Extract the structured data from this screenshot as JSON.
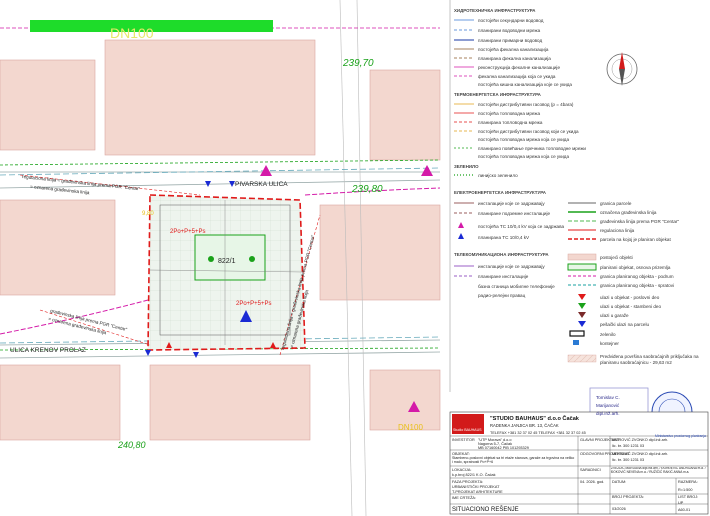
{
  "banner": {
    "label": "DN100"
  },
  "elevations": [
    "239,70",
    "239,80",
    "240,80"
  ],
  "dn_label_right": "DN100",
  "streets": {
    "pivarska": "PIVARSKA ULICA",
    "krenov": "ULICA KRENOV PROLAZ"
  },
  "plot_labels": {
    "parcel": "822/1",
    "building_top": "2Po+P+5+Ps",
    "building_bottom": "2Po+P+5+Ps",
    "corner": "9,80"
  },
  "diagonal_labels": {
    "left_a": "građevinska linija prema PGR \"Centar\"",
    "left_b": "= oznarena građevinska linija",
    "top_a": "regulaciona linija = građevinska linija prema PGR \"Centar\"",
    "top_b": "= oznarena građevinska linija",
    "right_a": "regulaciona linija = građevinska linija prema PGR \"Centar\"",
    "right_b": "= oznarena građevinska linija"
  },
  "legend_upper": {
    "sections": [
      {
        "title": "ХИДРОТЕХНИЧКА ИНФРАСТРУКТУРА",
        "items": [
          "постојећи секундарни водовод",
          "планирани водоводни мрежа",
          "планирани примарни водовод",
          "постојећа фекална канализација",
          "планирана фекална канализација",
          "реконструкција фекалне канализације",
          "фекална канализација која се укида",
          "постојећа кишна канализација које се укида"
        ]
      },
      {
        "title": "ТЕРМОЕНЕРГЕТСКА ИНФРАСТРУКТУРА",
        "items": [
          "постојећи дистрибутивни гасовод (p = 4bara)",
          "постојећа топловодна мрежа",
          "планирана топловодна мрежа",
          "постојећи дистрибутивни гасовод који се укида",
          "постојећа топловодна мрежа која се укида",
          "планирано повећање пречника топловодне мрежи",
          "постојећа топловодна мрежа која се укида"
        ]
      },
      {
        "title": "ЗЕЛЕНИЛО",
        "items": [
          "линијско зеленило"
        ]
      },
      {
        "title": "ЕЛЕКТРОЕНЕРГЕТСКА ИНФРАСТРУКТУРА",
        "items": [
          "инсталације које се задржавају",
          "планиране подземне инсталације",
          "постојећа ТС 10/0,4 kV која се задржава",
          "планирана ТС 10/0,4 kV"
        ]
      },
      {
        "title": "ТЕЛЕКОМУНИКАЦИОНА ИНФРАСТРУКТУРА",
        "items": [
          "инсталације које се задржавају",
          "планиране инсталације",
          "базна станица мобилне телефоније",
          "радио-релејни правац"
        ]
      }
    ]
  },
  "legend_lower": [
    "granica parcele",
    "označena građevinska linija",
    "građevinska linija prema PGR \"Centar\"",
    "regulaciona linija",
    "parcela na kojoj je planiran objekat",
    "postojeći objekti",
    "planirani objekat, osnova prizemlja",
    "granica planiranog objekta - podrum",
    "granica planiranog objekta - spratovi",
    "ulazi u objekat - poslovni deo",
    "ulazi u objekat - stambeni deo",
    "ulazi u garaže",
    "pešački ulazi na parcelu",
    "zelenilo",
    "kontejner",
    "Predviđena površina saobraćajnih priključaka na planiranu saobraćajnicu - 29,63 m2"
  ],
  "stamp": {
    "left_line1": "Tomislav C.",
    "left_line2": "Marijanović",
    "left_line3": "dipl.inž.arh.",
    "right_line": "Ministarstvo prostornog planiranja"
  },
  "title_block": {
    "logo_text": "Studio BAUHAUS",
    "company": "\"STUDIO BAUHAUS\" d.o.o Čačak",
    "address": "RADENKA JANJICA BR. 13, ČAČAK",
    "phone": "TELEFAX +381 32 37 02 45 TELEFAX +381 32 37 02 45",
    "investor_label": "INVESTITOR",
    "investor": "\"UTP Morava\" d.o.o",
    "investor_addr": "Nagorna 5-7, Čačak",
    "investor_id": "MB 07160042 PIB 101293329",
    "glavni_label": "GLAVNI PROJEKTANT",
    "glavni_name": "MITROVIĆ ZVONKO dipl.inž.arh.",
    "glavni_lic": "lic. br. 300 1231 03",
    "objekat_label": "OBJEKAT:",
    "objekat": "Stambeno-poslovni objekat sa tri etaže stanova, garaže za trgovina na veliko i malo, spratnosti Po+P+6",
    "odgovorni_label": "ODGOVORNI PROJEKTANT",
    "odgovorni_name": "MITROVIĆ ZVONKO dipl.inž.arh.",
    "odgovorni_lic": "lic. br. 300 1231 03",
    "lokacija_label": "LOKACIJA:",
    "lokacija": "k.p.broj 822/1 K.O. Čačak",
    "saradnici_label": "SARADNICI",
    "saradnici": "ZVEZDIĆ MARIJANA dipl.inž.arh. / ĐORĐEVIĆ ANDRIJANA m.a. / ĐOKOVIĆ NEVENA m.a. / RUŽIČIĆ RAKIĆ ANNA m.a.",
    "faza_label": "FAZA PROJEKTA:",
    "faza": "URBANISTIČKI PROJEKAT",
    "faza2": "T-PROJEKAT ARHITEKTURE",
    "crtez_label": "IME CRTEŽA:",
    "crtez": "SITUACIONO REŠENJE",
    "datum_label": "DATUM:",
    "datum": "04. 2026. god.",
    "razmera_label": "RAZMERA:",
    "razmera": "R=1:500",
    "broj_label": "BROJ PROJEKTA:",
    "broj": "03/2026",
    "list_label": "LIST BROJ:",
    "list": "UP",
    "list_no": "A60-01"
  },
  "colors": {
    "banner": "#1edc2a",
    "magenta": "#d41aa8",
    "red_dashed": "#e01a1a",
    "green_line": "#1aa21a",
    "blue_entry": "#1a2ad4",
    "building_fill": "#f3d7cf"
  }
}
